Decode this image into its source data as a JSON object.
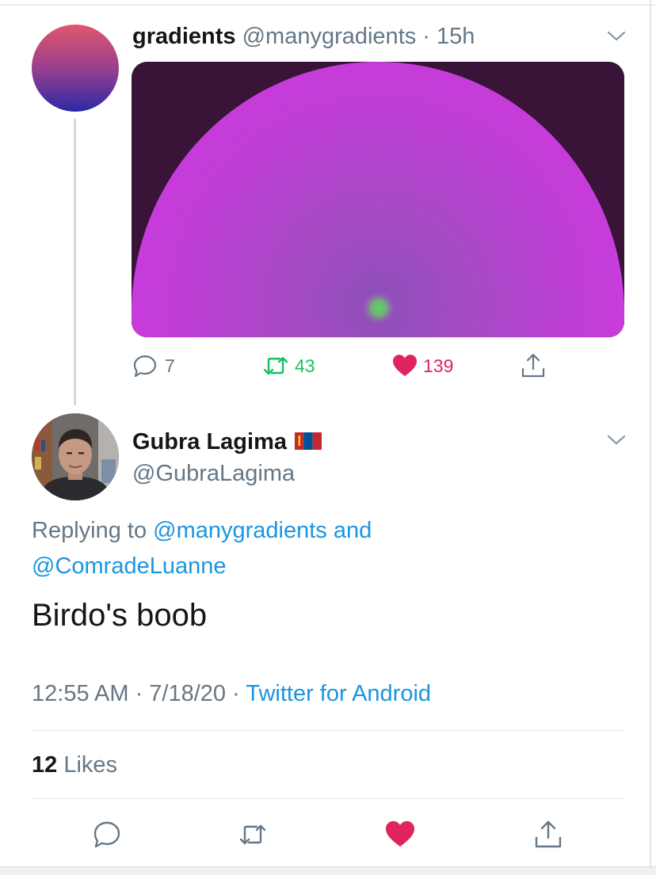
{
  "tweet": {
    "author_name": "gradients",
    "author_handle": "@manygradients",
    "time": "15h",
    "replies": "7",
    "retweets": "43",
    "likes": "139"
  },
  "reply": {
    "author_name": "Gubra Lagima",
    "author_handle": "@GubraLagima",
    "replying_prefix": "Replying to",
    "replying_to_1": "@manygradients and",
    "replying_to_2": "@ComradeLuanne",
    "text": "Birdo's boob",
    "timestamp": "12:55 AM · 7/18/20 ·",
    "source": "Twitter for Android",
    "likes_count": "12",
    "likes_label": "Likes"
  },
  "colors": {
    "retweet_green": "#17bf63",
    "like_red": "#e0245e",
    "link_blue": "#1b95e0",
    "muted_gray": "#657786",
    "media_background": "#3a1339",
    "media_semicircle": "#c63cd6"
  },
  "icons": [
    "reply-icon",
    "retweet-icon",
    "like-icon",
    "share-icon",
    "chevron-down-icon",
    "mongolia-flag-icon"
  ]
}
